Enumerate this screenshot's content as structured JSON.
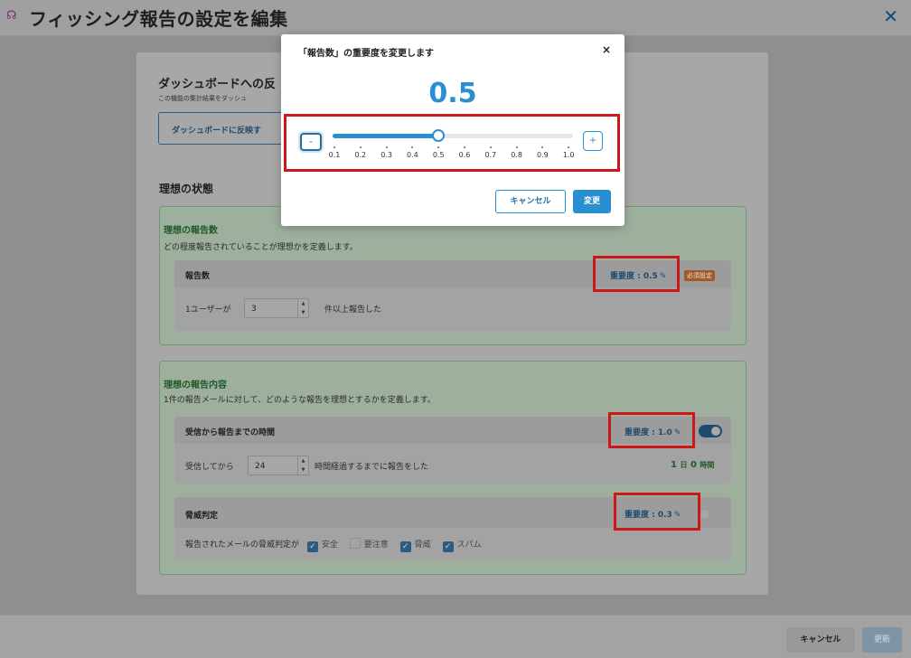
{
  "header": {
    "title": "フィッシング報告の設定を編集",
    "close_glyph": "✕"
  },
  "dashboard": {
    "title": "ダッシュボードへの反",
    "subtitle": "この機能の集計結果をダッシュ",
    "button_label": "ダッシュボードに反映す"
  },
  "ideal": {
    "title": "理想の状態"
  },
  "report_count_section": {
    "title": "理想の報告数",
    "description": "どの程度報告されていることが理想かを定義します。",
    "panel": {
      "name": "報告数",
      "importance_label": "重要度 : 0.5",
      "required_badge": "必須設定",
      "prefix": "1ユーザーが",
      "value": "3",
      "suffix": "件以上報告した"
    }
  },
  "report_content_section": {
    "title": "理想の報告内容",
    "description": "1件の報告メールに対して、どのような報告を理想とするかを定義します。",
    "time_panel": {
      "name": "受信から報告までの時間",
      "importance_label": "重要度 : 1.0",
      "toggle_on": true,
      "prefix": "受信してから",
      "value": "24",
      "suffix": "時間経過するまでに報告をした",
      "duration_days": "1",
      "duration_days_unit": "日",
      "duration_hours": "0",
      "duration_hours_unit": "時間"
    },
    "threat_panel": {
      "name": "脅威判定",
      "importance_label": "重要度 : 0.3",
      "toggle_on": false,
      "prefix": "報告されたメールの脅威判定が",
      "options": [
        {
          "label": "安全",
          "checked": true
        },
        {
          "label": "要注意",
          "checked": false
        },
        {
          "label": "脅威",
          "checked": true
        },
        {
          "label": "スパム",
          "checked": true
        }
      ]
    }
  },
  "footer": {
    "cancel_label": "キャンセル",
    "update_label": "更新"
  },
  "modal": {
    "title": "「報告数」の重要度を変更します",
    "close_glyph": "×",
    "value_display": "0.5",
    "slider_value": 0.5,
    "slider_min": 0.1,
    "slider_max": 1.0,
    "minus_glyph": "-",
    "plus_glyph": "+",
    "ticks": [
      "0.1",
      "0.2",
      "0.3",
      "0.4",
      "0.5",
      "0.6",
      "0.7",
      "0.8",
      "0.9",
      "1.0"
    ],
    "cancel_label": "キャンセル",
    "change_label": "変更"
  },
  "icons": {
    "logo": "headset-icon",
    "edit": "edit-icon"
  },
  "colors": {
    "accent": "#2a8fd0",
    "highlight": "#cc1818",
    "section_title": "#1f5a2a"
  }
}
